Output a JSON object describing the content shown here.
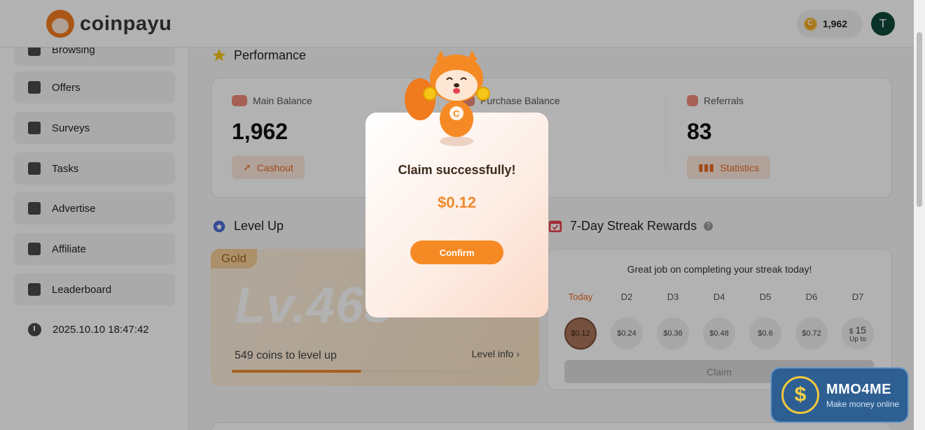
{
  "header": {
    "brand": "coinpayu",
    "coin_balance": "1,962",
    "avatar_initial": "T"
  },
  "sidebar": {
    "items": [
      {
        "label": "Browsing",
        "icon": "cursor-icon"
      },
      {
        "label": "Offers",
        "icon": "document-check-icon"
      },
      {
        "label": "Surveys",
        "icon": "clipboard-list-icon"
      },
      {
        "label": "Tasks",
        "icon": "tasks-icon"
      },
      {
        "label": "Advertise",
        "icon": "bar-chart-icon"
      },
      {
        "label": "Affiliate",
        "icon": "users-icon"
      },
      {
        "label": "Leaderboard",
        "icon": "trophy-icon"
      }
    ],
    "datetime": "2025.10.10 18:47:42"
  },
  "performance": {
    "title": "Performance",
    "main_balance": {
      "label": "Main Balance",
      "value": "1,962",
      "button": "Cashout"
    },
    "purchase_balance": {
      "label": "Purchase Balance"
    },
    "referrals": {
      "label": "Referrals",
      "value": "83",
      "button": "Statistics"
    }
  },
  "level_up": {
    "title": "Level Up",
    "tier": "Gold",
    "level": "Lv.463",
    "coins_to_level": "549 coins to level up",
    "level_info": "Level info ›",
    "progress": 0.45
  },
  "streak": {
    "title": "7-Day Streak Rewards",
    "message": "Great job on completing your streak today!",
    "days": [
      {
        "label": "Today",
        "amount": "$0.12"
      },
      {
        "label": "D2",
        "amount": "$0.24"
      },
      {
        "label": "D3",
        "amount": "$0.36"
      },
      {
        "label": "D4",
        "amount": "$0.48"
      },
      {
        "label": "D5",
        "amount": "$0.6"
      },
      {
        "label": "D6",
        "amount": "$0.72"
      },
      {
        "label": "D7",
        "amount_prefix": "$",
        "amount": "15",
        "note": "Up to"
      }
    ],
    "claim_label": "Claim"
  },
  "modal": {
    "title": "Claim successfully!",
    "amount": "$0.12",
    "confirm_label": "Confirm"
  },
  "watermark": {
    "title": "MMO4ME",
    "subtitle": "Make money online"
  },
  "colors": {
    "accent": "#f58a24",
    "brand_orange": "#f47c20",
    "avatar_bg": "#0f4a3a"
  }
}
